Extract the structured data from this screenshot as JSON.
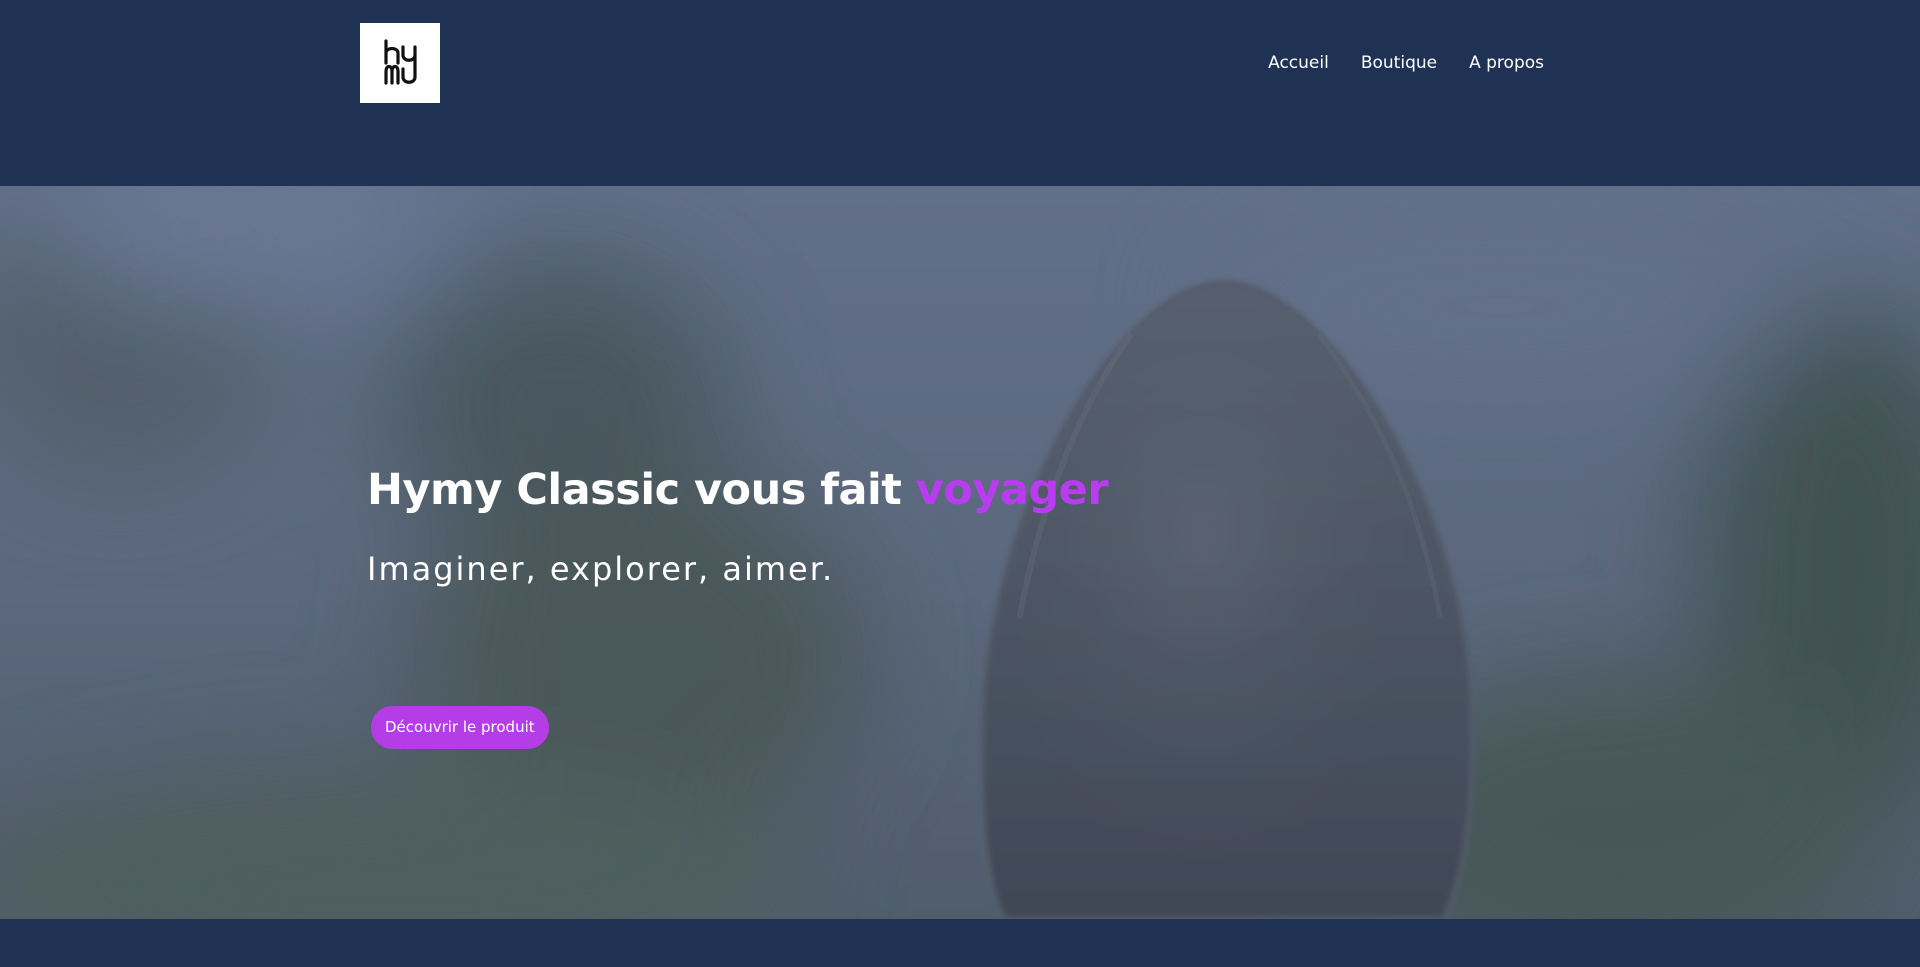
{
  "header": {
    "logo_alt": "hymy",
    "nav": [
      {
        "label": "Accueil"
      },
      {
        "label": "Boutique"
      },
      {
        "label": "A propos"
      }
    ]
  },
  "hero": {
    "title_main": "Hymy Classic vous fait ",
    "title_accent": "voyager",
    "subtitle": "Imaginer, explorer, aimer.",
    "cta_label": "Découvrir le produit"
  },
  "colors": {
    "header_bg": "#1f3253",
    "accent": "#b93cf0",
    "button_bg": "#b43de8",
    "text": "#ffffff"
  },
  "icons": {
    "logo": "hymy-logo-icon"
  }
}
